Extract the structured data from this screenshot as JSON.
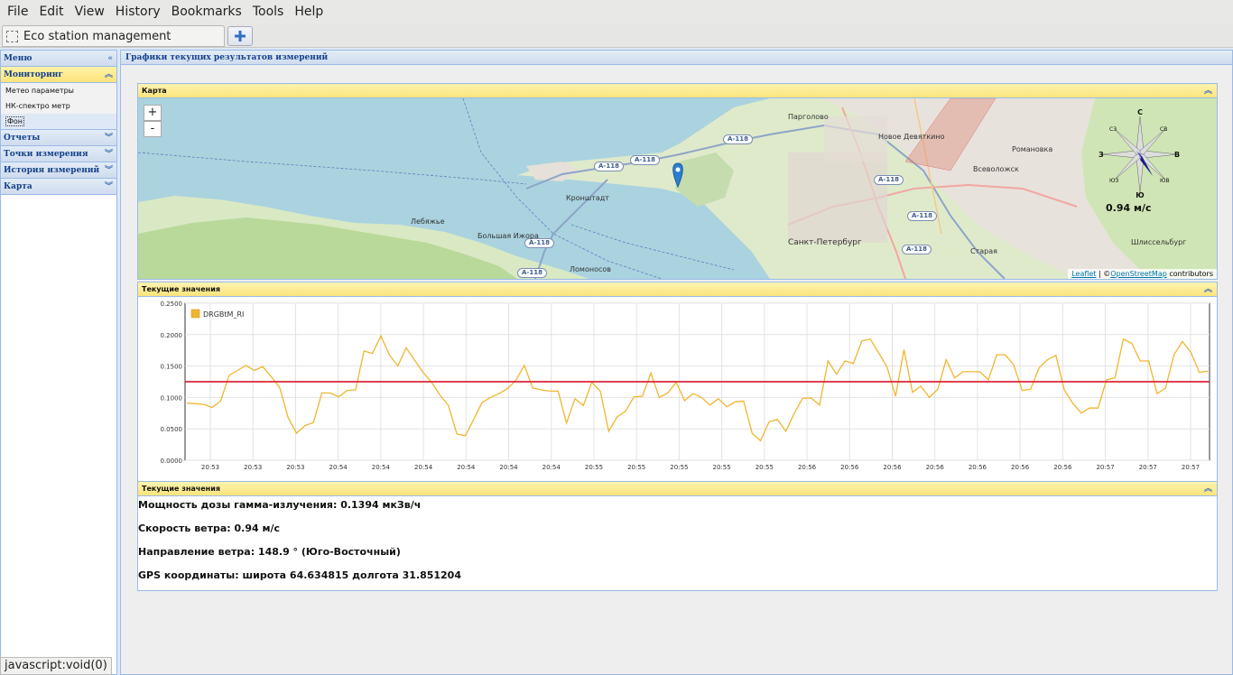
{
  "browser": {
    "menu": [
      {
        "label": "File"
      },
      {
        "label": "Edit"
      },
      {
        "label": "View"
      },
      {
        "label": "History"
      },
      {
        "label": "Bookmarks"
      },
      {
        "label": "Tools"
      },
      {
        "label": "Help"
      }
    ],
    "tab_title": "Eco station management",
    "status_url": "javascript:void(0)"
  },
  "sidebar": {
    "title": "Меню",
    "sections": [
      {
        "label": "Мониторинг",
        "active": true
      },
      {
        "label": "Отчеты"
      },
      {
        "label": "Точки измерения"
      },
      {
        "label": "История измерений"
      },
      {
        "label": "Карта"
      }
    ],
    "monitoring_items": [
      {
        "label": "Метео параметры"
      },
      {
        "label": "НК-спектро метр"
      },
      {
        "label": "Фон"
      }
    ]
  },
  "main": {
    "title": "Графики текущих результатов измерений",
    "map_panel_title": "Карта",
    "chart_panel_title": "Текущие значения",
    "values_panel_title": "Текущие значения",
    "map": {
      "zoom_in": "+",
      "zoom_out": "-",
      "wind_speed_label": "0.94 м/с",
      "attribution": {
        "leaflet": "Leaflet",
        "sep": " | ©",
        "osm": "OpenStreetMap",
        "contrib": " contributors"
      },
      "compass": {
        "n": "С",
        "s": "Ю",
        "e": "В",
        "w": "З",
        "ne": "СВ",
        "nw": "СЗ",
        "se": "ЮВ",
        "sw": "ЮЗ"
      },
      "highways": [
        "А-118",
        "А-118",
        "А-118",
        "А-118",
        "А-118",
        "А-118",
        "А-118",
        "А-118"
      ],
      "cities": [
        "Санкт-Петербург",
        "Кронштадт",
        "Ломоносов",
        "Парголово",
        "Романовка",
        "Всеволожск",
        "Шлиссельбург",
        "Старая",
        "Лебяжье",
        "Большая Ижора",
        "Новое Девяткино"
      ]
    },
    "values": {
      "dose_rate": "Мощность дозы гамма-излучения: 0.1394 мкЗв/ч",
      "wind_speed": "Скорость ветра: 0.94 м/с",
      "wind_direction": "Направление ветра: 148.9 ° (Юго-Восточный)",
      "gps": "GPS координаты: широта 64.634815 долгота 31.851204"
    }
  },
  "colors": {
    "series": "#f0b62e",
    "threshold": "#d9263a",
    "panel_border": "#99bbe8"
  },
  "chart_data": {
    "type": "line",
    "title": "",
    "xlabel": "",
    "ylabel": "",
    "legend": "top-left",
    "grid": true,
    "ylim": [
      0,
      0.25
    ],
    "yticks": [
      "0.0000",
      "0.0500",
      "0.1000",
      "0.1500",
      "0.2000",
      "0.2500"
    ],
    "xticks": [
      "20:53",
      "20:53",
      "20:53",
      "20:54",
      "20:54",
      "20:54",
      "20:54",
      "20:54",
      "20:54",
      "20:55",
      "20:55",
      "20:55",
      "20:55",
      "20:55",
      "20:56",
      "20:56",
      "20:56",
      "20:56",
      "20:56",
      "20:56",
      "20:56",
      "20:57",
      "20:57",
      "20:57"
    ],
    "threshold": 0.125,
    "series": [
      {
        "name": "DRGBtM_RI",
        "values": [
          0.091,
          0.09,
          0.089,
          0.084,
          0.094,
          0.135,
          0.143,
          0.151,
          0.143,
          0.149,
          0.133,
          0.116,
          0.068,
          0.043,
          0.055,
          0.06,
          0.107,
          0.107,
          0.101,
          0.111,
          0.112,
          0.174,
          0.17,
          0.198,
          0.168,
          0.15,
          0.179,
          0.159,
          0.14,
          0.124,
          0.104,
          0.087,
          0.042,
          0.039,
          0.065,
          0.092,
          0.1,
          0.106,
          0.114,
          0.127,
          0.151,
          0.115,
          0.112,
          0.11,
          0.11,
          0.059,
          0.098,
          0.087,
          0.124,
          0.11,
          0.046,
          0.069,
          0.078,
          0.101,
          0.102,
          0.139,
          0.1,
          0.107,
          0.124,
          0.095,
          0.106,
          0.1,
          0.088,
          0.098,
          0.085,
          0.093,
          0.094,
          0.043,
          0.031,
          0.061,
          0.065,
          0.046,
          0.075,
          0.099,
          0.099,
          0.088,
          0.158,
          0.137,
          0.158,
          0.154,
          0.19,
          0.193,
          0.171,
          0.148,
          0.102,
          0.176,
          0.108,
          0.118,
          0.1,
          0.113,
          0.16,
          0.131,
          0.141,
          0.141,
          0.141,
          0.128,
          0.168,
          0.168,
          0.152,
          0.111,
          0.113,
          0.147,
          0.16,
          0.167,
          0.112,
          0.091,
          0.075,
          0.083,
          0.083,
          0.128,
          0.131,
          0.193,
          0.186,
          0.158,
          0.158,
          0.106,
          0.115,
          0.168,
          0.189,
          0.172,
          0.14,
          0.142
        ]
      }
    ]
  }
}
